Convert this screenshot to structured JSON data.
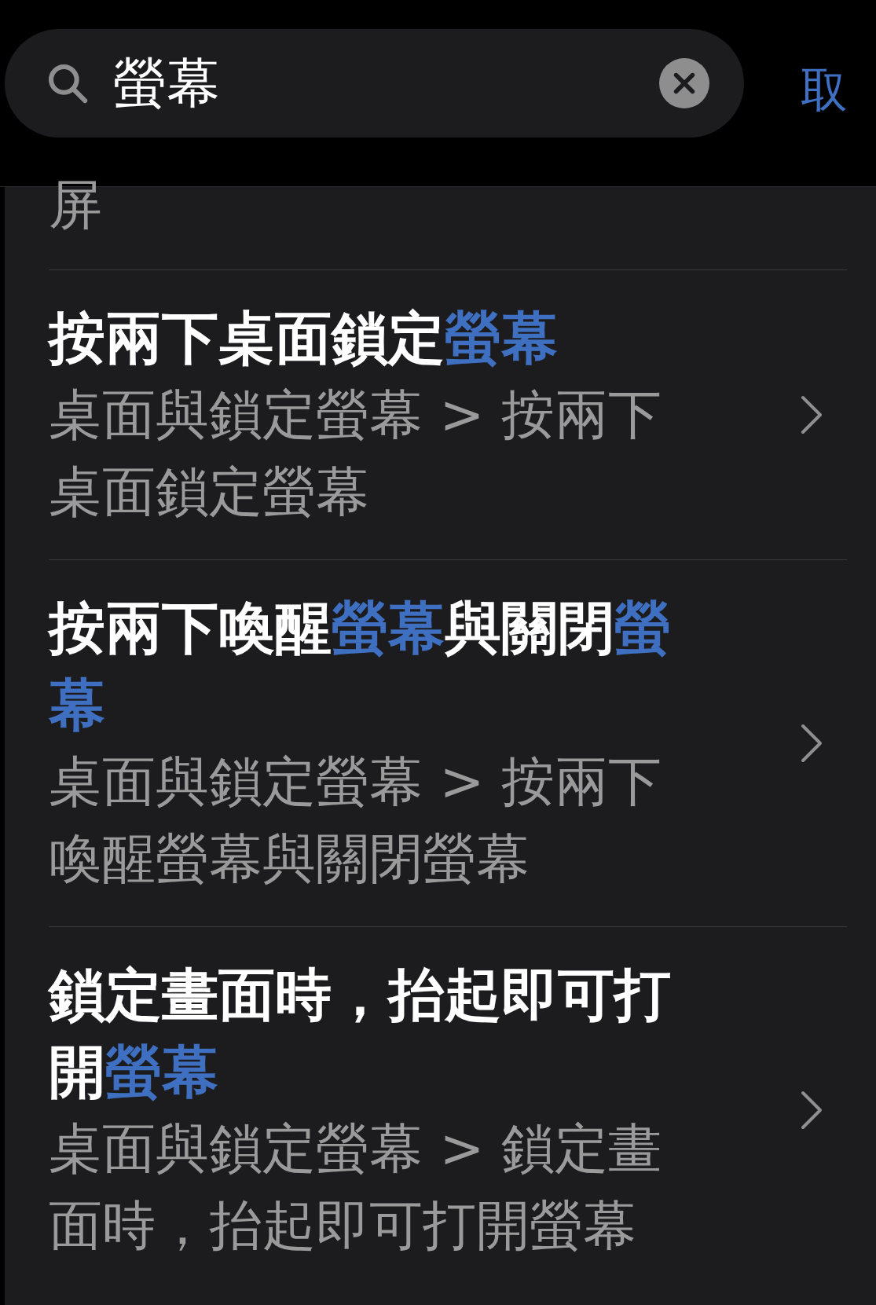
{
  "search": {
    "value": "螢幕"
  },
  "cancel": "取",
  "clipped_result": {
    "path": "屏"
  },
  "results": [
    {
      "title": [
        {
          "text": "按兩下桌面鎖定",
          "highlight": false
        },
        {
          "text": "螢幕",
          "highlight": true
        }
      ],
      "path": "桌面與鎖定螢幕 > 按兩下桌面鎖定螢幕"
    },
    {
      "title": [
        {
          "text": "按兩下喚醒",
          "highlight": false
        },
        {
          "text": "螢幕",
          "highlight": true
        },
        {
          "text": "與關閉",
          "highlight": false
        },
        {
          "text": "螢幕",
          "highlight": true
        }
      ],
      "path": "桌面與鎖定螢幕 > 按兩下喚醒螢幕與關閉螢幕"
    },
    {
      "title": [
        {
          "text": "鎖定畫面時，抬起即可打開",
          "highlight": false
        },
        {
          "text": "螢幕",
          "highlight": true
        }
      ],
      "path": "桌面與鎖定螢幕 > 鎖定畫面時，抬起即可打開螢幕"
    }
  ]
}
